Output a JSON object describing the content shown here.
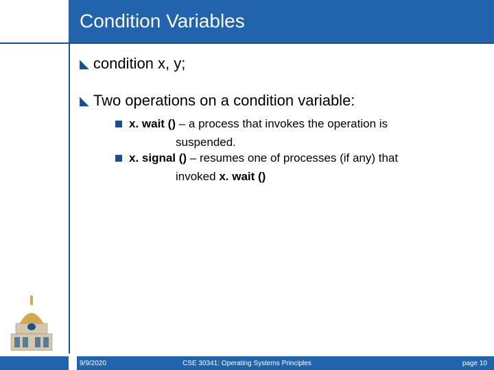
{
  "title": "Condition Variables",
  "bullets": {
    "line1": "condition x, y;",
    "line2": "Two operations on a condition variable:",
    "sub1_bold": "x. wait () ",
    "sub1_rest": " – a process that invokes the operation is",
    "sub1_cont": "suspended.",
    "sub2_bold": "x. signal () ",
    "sub2_rest": "– resumes one of processes (if any) that",
    "sub2_cont_a": "invoked ",
    "sub2_cont_bold": "x. wait ()"
  },
  "footer": {
    "date": "9/9/2020",
    "course": "CSE 30341: Operating Systems Principles",
    "page": "page 10"
  }
}
